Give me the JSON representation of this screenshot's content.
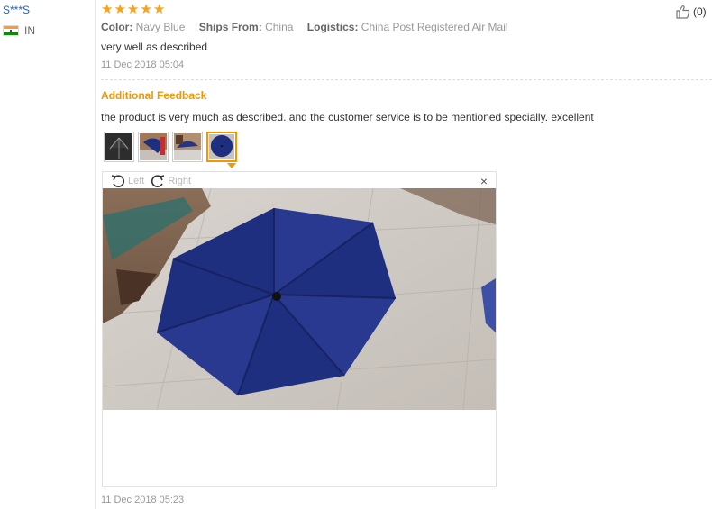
{
  "user": {
    "name": "S***S",
    "country": "IN"
  },
  "rating": {
    "stars": 5,
    "max": 5
  },
  "helpful": {
    "count_label": "(0)"
  },
  "attributes": [
    {
      "key": "Color:",
      "value": "Navy Blue"
    },
    {
      "key": "Ships From:",
      "value": "China"
    },
    {
      "key": "Logistics:",
      "value": "China Post Registered Air Mail"
    }
  ],
  "review": {
    "text": "very well as described",
    "date": "11 Dec 2018 05:04"
  },
  "additional_feedback": {
    "title": "Additional Feedback",
    "text": "the product is very much as described. and the customer service is to be mentioned specially. excellent",
    "date": "11 Dec 2018 05:23"
  },
  "viewer": {
    "rotate_left_label": "Left",
    "rotate_right_label": "Right",
    "close_label": "×"
  },
  "colors": {
    "accent": "#f39800",
    "link": "#2a62b6",
    "star": "#f7a21a",
    "umbrella": "#1f2f7f"
  }
}
